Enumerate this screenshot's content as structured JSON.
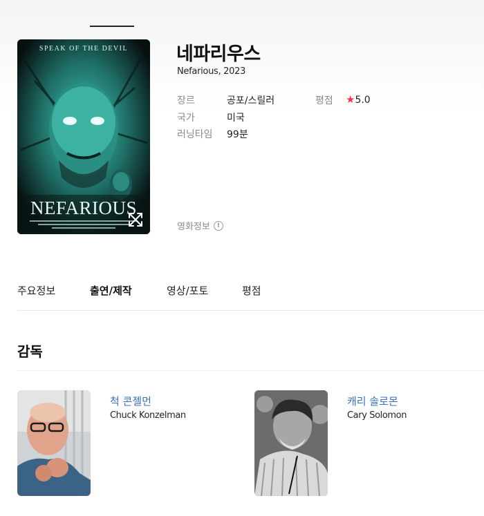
{
  "movie": {
    "title": "네파리우스",
    "subtitle": "Nefarious, 2023",
    "poster": {
      "tagline": "SPEAK OF THE DEVIL",
      "wordmark": "NEFARIOUS",
      "alt_icon": "expand-icon"
    },
    "meta": [
      {
        "label": "장르",
        "value": "공포/스릴러"
      },
      {
        "label": "국가",
        "value": "미국"
      },
      {
        "label": "러닝타임",
        "value": "99분"
      }
    ],
    "rating": {
      "label": "평점",
      "star": "★",
      "value": "5.0"
    },
    "info_link": {
      "label": "영화정보",
      "icon": "!"
    }
  },
  "tabs": [
    {
      "label": "주요정보",
      "active": false
    },
    {
      "label": "출연/제작",
      "active": true
    },
    {
      "label": "영상/포토",
      "active": false
    },
    {
      "label": "평점",
      "active": false
    }
  ],
  "section": {
    "title": "감독"
  },
  "directors": [
    {
      "name_ko": "척 콘젤먼",
      "name_en": "Chuck Konzelman"
    },
    {
      "name_ko": "캐리 솔로몬",
      "name_en": "Cary Solomon"
    }
  ],
  "colors": {
    "accent_star": "#ff2f4e",
    "link": "#3a6fbf",
    "poster_teal": "#3fc6b4"
  }
}
